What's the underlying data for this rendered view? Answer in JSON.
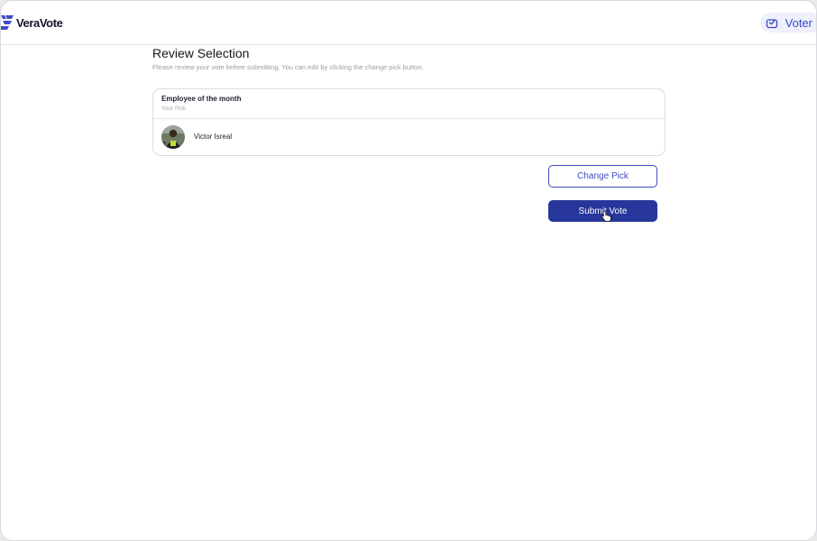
{
  "app": {
    "name": "VeraVote",
    "role_label": "Voter"
  },
  "icons": {
    "logo": "veravote-logo-icon",
    "voter": "ballot-box-icon",
    "cursor": "hand-pointer-icon"
  },
  "colors": {
    "brand": "#3f4bc5",
    "primary_button": "#27369a",
    "pill_background": "#eef0fb"
  },
  "review": {
    "title": "Review Selection",
    "subtitle": "Please review your vote before submitting. You can edit by clicking the change pick button.",
    "selection": {
      "category": "Employee of the month",
      "pick_label": "Your Pick",
      "nominee_name": "Victor Isreal"
    }
  },
  "actions": {
    "change_label": "Change Pick",
    "submit_label": "Submit Vote"
  }
}
